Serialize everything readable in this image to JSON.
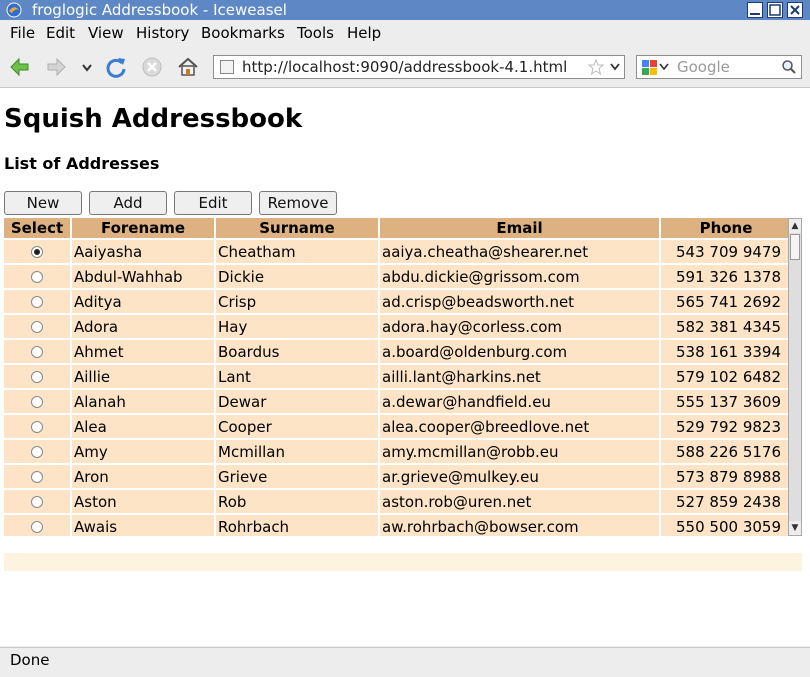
{
  "window": {
    "title": "froglogic Addressbook - Iceweasel"
  },
  "menubar": {
    "items": [
      "File",
      "Edit",
      "View",
      "History",
      "Bookmarks",
      "Tools",
      "Help"
    ]
  },
  "navbar": {
    "url": "http://localhost:9090/addressbook-4.1.html",
    "search_placeholder": "Google"
  },
  "page": {
    "title": "Squish Addressbook",
    "subtitle": "List of Addresses",
    "buttons": {
      "new": "New",
      "add": "Add",
      "edit": "Edit",
      "remove": "Remove"
    }
  },
  "table": {
    "headers": [
      "Select",
      "Forename",
      "Surname",
      "Email",
      "Phone"
    ],
    "rows": [
      {
        "selected": true,
        "forename": "Aaiyasha",
        "surname": "Cheatham",
        "email": "aaiya.cheatha@shearer.net",
        "phone": "543 709 9479"
      },
      {
        "selected": false,
        "forename": "Abdul-Wahhab",
        "surname": "Dickie",
        "email": "abdu.dickie@grissom.com",
        "phone": "591 326 1378"
      },
      {
        "selected": false,
        "forename": "Aditya",
        "surname": "Crisp",
        "email": "ad.crisp@beadsworth.net",
        "phone": "565 741 2692"
      },
      {
        "selected": false,
        "forename": "Adora",
        "surname": "Hay",
        "email": "adora.hay@corless.com",
        "phone": "582 381 4345"
      },
      {
        "selected": false,
        "forename": "Ahmet",
        "surname": "Boardus",
        "email": "a.board@oldenburg.com",
        "phone": "538 161 3394"
      },
      {
        "selected": false,
        "forename": "Aillie",
        "surname": "Lant",
        "email": "ailli.lant@harkins.net",
        "phone": "579 102 6482"
      },
      {
        "selected": false,
        "forename": "Alanah",
        "surname": "Dewar",
        "email": "a.dewar@handfield.eu",
        "phone": "555 137 3609"
      },
      {
        "selected": false,
        "forename": "Alea",
        "surname": "Cooper",
        "email": "alea.cooper@breedlove.net",
        "phone": "529 792 9823"
      },
      {
        "selected": false,
        "forename": "Amy",
        "surname": "Mcmillan",
        "email": "amy.mcmillan@robb.eu",
        "phone": "588 226 5176"
      },
      {
        "selected": false,
        "forename": "Aron",
        "surname": "Grieve",
        "email": "ar.grieve@mulkey.eu",
        "phone": "573 879 8988"
      },
      {
        "selected": false,
        "forename": "Aston",
        "surname": "Rob",
        "email": "aston.rob@uren.net",
        "phone": "527 859 2438"
      },
      {
        "selected": false,
        "forename": "Awais",
        "surname": "Rohrbach",
        "email": "aw.rohrbach@bowser.com",
        "phone": "550 500 3059"
      }
    ]
  },
  "status": {
    "text": "Done"
  },
  "colors": {
    "titlebar": "#5d88c5",
    "header_cell": "#ddb180",
    "row_cell": "#fde4c7"
  },
  "icons": [
    "back-icon",
    "forward-icon",
    "history-dropdown-icon",
    "reload-icon",
    "stop-icon",
    "home-icon",
    "bookmark-star-icon",
    "google-icon",
    "search-icon"
  ]
}
